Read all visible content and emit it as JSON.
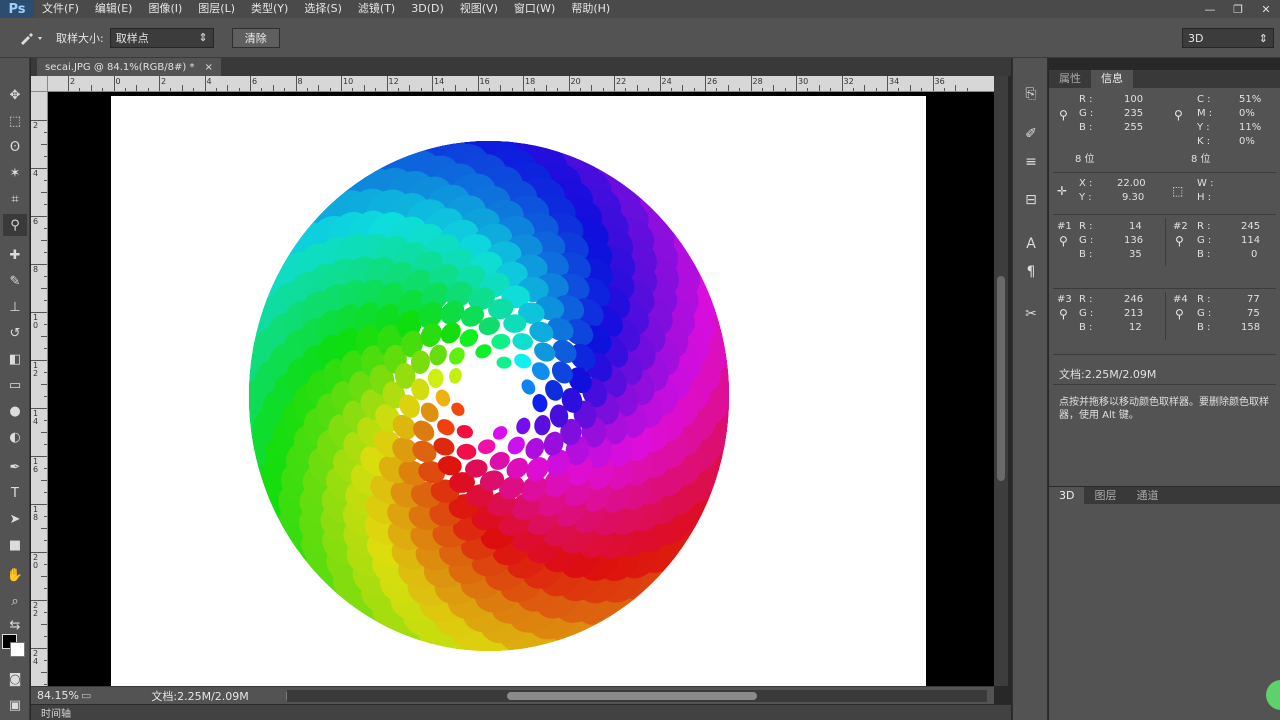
{
  "app": {
    "logo": "Ps",
    "menu": [
      "文件(F)",
      "编辑(E)",
      "图像(I)",
      "图层(L)",
      "类型(Y)",
      "选择(S)",
      "滤镜(T)",
      "3D(D)",
      "视图(V)",
      "窗口(W)",
      "帮助(H)"
    ],
    "window_controls": [
      "—",
      "❐",
      "✕"
    ]
  },
  "options": {
    "sample_size_label": "取样大小:",
    "sample_size_value": "取样点",
    "clear_button": "清除",
    "workspace": "3D"
  },
  "document": {
    "tab_title": "secai.JPG @ 84.1%(RGB/8#) *",
    "tab_close": "×",
    "ruler_h_labels": [
      "2",
      "0",
      "2",
      "4",
      "6",
      "8",
      "10",
      "12",
      "14",
      "16",
      "18",
      "20",
      "22",
      "24",
      "26",
      "28",
      "30",
      "32",
      "34",
      "36"
    ],
    "ruler_v_labels": [
      "2",
      "4",
      "6",
      "8",
      "1 0",
      "1 2",
      "1 4",
      "1 6",
      "1 8",
      "2 0",
      "2 2",
      "2 4"
    ]
  },
  "status": {
    "zoom": "84.15%",
    "doc_size": "文档:2.25M/2.09M",
    "timeline": "时间轴"
  },
  "panel": {
    "tab_properties": "属性",
    "tab_info": "信息",
    "rgb": {
      "r_label": "R :",
      "g_label": "G :",
      "b_label": "B :",
      "r": "100",
      "g": "235",
      "b": "255",
      "bits": "8 位"
    },
    "cmyk": {
      "c_label": "C :",
      "m_label": "M :",
      "y_label": "Y :",
      "k_label": "K :",
      "c": "51%",
      "m": "0%",
      "y": "11%",
      "k": "0%",
      "bits": "8 位"
    },
    "pos": {
      "x_label": "X :",
      "y_label": "Y :",
      "x": "22.00",
      "y": "9.30"
    },
    "size": {
      "w_label": "W :",
      "h_label": "H :"
    },
    "samplers": [
      {
        "id": "#1",
        "r": "14",
        "g": "136",
        "b": "35"
      },
      {
        "id": "#2",
        "r": "245",
        "g": "114",
        "b": "0"
      },
      {
        "id": "#3",
        "r": "246",
        "g": "213",
        "b": "12"
      },
      {
        "id": "#4",
        "r": "77",
        "g": "75",
        "b": "158"
      }
    ],
    "doc_info": "文档:2.25M/2.09M",
    "hint": "点按并拖移以移动颜色取样器。要删除颜色取样器，使用 Alt 键。",
    "lower_tabs": [
      "3D",
      "图层",
      "通道"
    ]
  }
}
